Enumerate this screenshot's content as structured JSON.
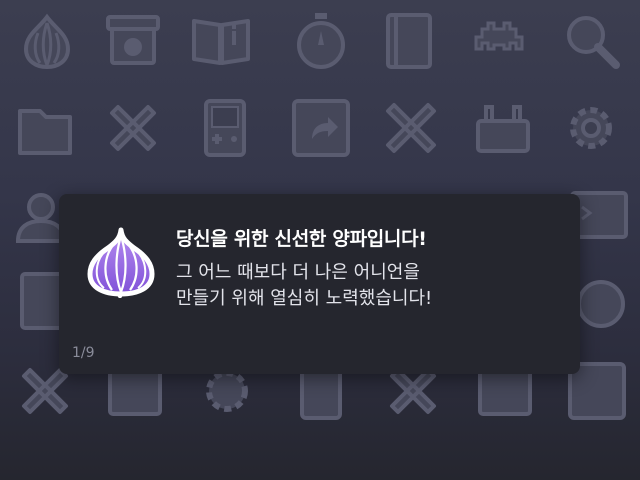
{
  "background": {
    "icons": [
      "onion-icon",
      "box-onion-icon",
      "book-info-icon",
      "stopwatch-icon",
      "notebook-icon",
      "space-invader-icon",
      "magnifier-icon",
      "folder-icon",
      "tools-cross-icon",
      "gameboy-icon",
      "share-arrow-icon",
      "ruler-pencil-cross-icon",
      "toolbox-icon",
      "gear-icon",
      "user-refresh-icon",
      "",
      "",
      "",
      "",
      "",
      "terminal-icon",
      "document-icon",
      "",
      "",
      "",
      "",
      "",
      "stopwatch-icon",
      "tools-cross-icon",
      "box-icon",
      "gear-icon",
      "gameboy-icon",
      "tools-cross-icon",
      "toolbox-icon",
      "share-arrow-icon"
    ],
    "colors": {
      "top": "#3c3e50",
      "bottom": "#25262f",
      "icon_stroke": "#5a5c70",
      "icon_fill": "#454759"
    }
  },
  "notification": {
    "title": "당신을 위한 신선한 양파입니다!",
    "body_lines": [
      "그 어느 때보다 더 나은 어니언을",
      "만들기 위해 열심히 노력했습니다!"
    ],
    "counter": "1/9",
    "logo": "tor-onion-icon",
    "colors": {
      "background": "#25262e",
      "title": "#ffffff",
      "body": "#e2e3ea",
      "counter": "#8a8c9a",
      "onion": "#9b6fe0"
    }
  }
}
